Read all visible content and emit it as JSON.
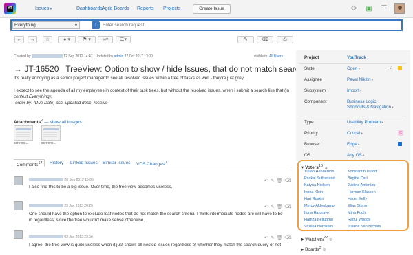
{
  "header": {
    "logo_text": "YT",
    "nav": [
      "Issues",
      "Dashboards",
      "Agile Boards",
      "Reports",
      "Projects"
    ],
    "create_label": "Create Issue"
  },
  "search": {
    "context": "Everything",
    "placeholder": "Enter search request"
  },
  "meta": {
    "created_label": "Created by",
    "created_date": "12 Sep 2012 14:47",
    "updated_label": "Updated by",
    "updated_by": "admin",
    "updated_date": "27 Oct 2017 13:00",
    "visible_label": "visible to:",
    "visible_value": "All Users"
  },
  "issue": {
    "id": "JT-16520",
    "title": "TreeView: Option to show / hide Issues, that do not match search criteria",
    "desc1": "It's really annoying as a senior project manager to see all resolved issues within a tree of tasks as well - they're just grey.",
    "desc2": "I expect to see the agenda of all my employees in context of their task trees, but without the resolved issues, when i submit a search like that (in",
    "desc3": "context Everything):",
    "desc4": "-order by: {Due Date} asc, updated desc -resolve"
  },
  "attachments": {
    "label": "Attachments",
    "count": "2",
    "show_all": "— show all images",
    "files": [
      "screens...",
      "screens..."
    ]
  },
  "tabs": [
    {
      "label": "Comments",
      "count": "17"
    },
    {
      "label": "History"
    },
    {
      "label": "Linked Issues"
    },
    {
      "label": "Similar Issues"
    },
    {
      "label": "VCS Changes",
      "count": "0"
    }
  ],
  "comments": [
    {
      "date": "26 Sep 2012 15:05",
      "text": "I also find this to be a big issue. Over time, the tree view becomes useless."
    },
    {
      "date": "23 Jan 2013 20:29",
      "text1": "One should have the option to exclude leaf nodes that do not match the search criteria. I think intermediate nodes are will have to be",
      "text2": "in regardless, since the tree wouldn't make sense otherwise."
    },
    {
      "date": "03 Jan 2013 23:56",
      "text": "I agree, the tree view is quite useless when it just shows all nested issues regardless of whether they match the search query or not"
    }
  ],
  "fields": {
    "project_label": "Project",
    "project_value": "YouTrack",
    "state_label": "State",
    "state_value": "Open",
    "assignee_label": "Assignee",
    "assignee_value": "Pavel Nikitin",
    "subsystem_label": "Subsystem",
    "subsystem_value": "Import",
    "component_label": "Component",
    "component_value1": "Business Logic,",
    "component_value2": "Shortcuts & Navigation",
    "type_label": "Type",
    "type_value": "Usability Problem",
    "priority_label": "Priority",
    "priority_value": "Critical",
    "priority_badge": "C",
    "browser_label": "Browser",
    "browser_value": "Edge",
    "os_label": "OS",
    "os_value": "Any OS"
  },
  "colors": {
    "accent": "#3a78c3",
    "state": "#f5c518",
    "priority": "#e040a0",
    "browser": "#1a6fd8",
    "highlight": "#f0a040"
  },
  "voters": {
    "label": "Voters",
    "count": "16",
    "names": [
      "Yulian Henderson",
      "Konstantin Dufort",
      "Paskal Sutherland",
      "Birgitte Carl",
      "Katyna Nielsen",
      "Justine Antoniou",
      "Ivona Klein",
      "Herman Klasson",
      "Hari Ruskin",
      "Hacer Kelly",
      "Mercy Aldenkamp",
      "Elias Sturm",
      "Ilona Hargrave",
      "Mina Pugh",
      "Hamza Belluomo",
      "Raoul Woods",
      "Vasilka Nordskov",
      "Juliane San Nicolas"
    ]
  },
  "watchers": {
    "label": "Watchers",
    "count": "22"
  },
  "boards": {
    "label": "Boards",
    "count": "3"
  }
}
